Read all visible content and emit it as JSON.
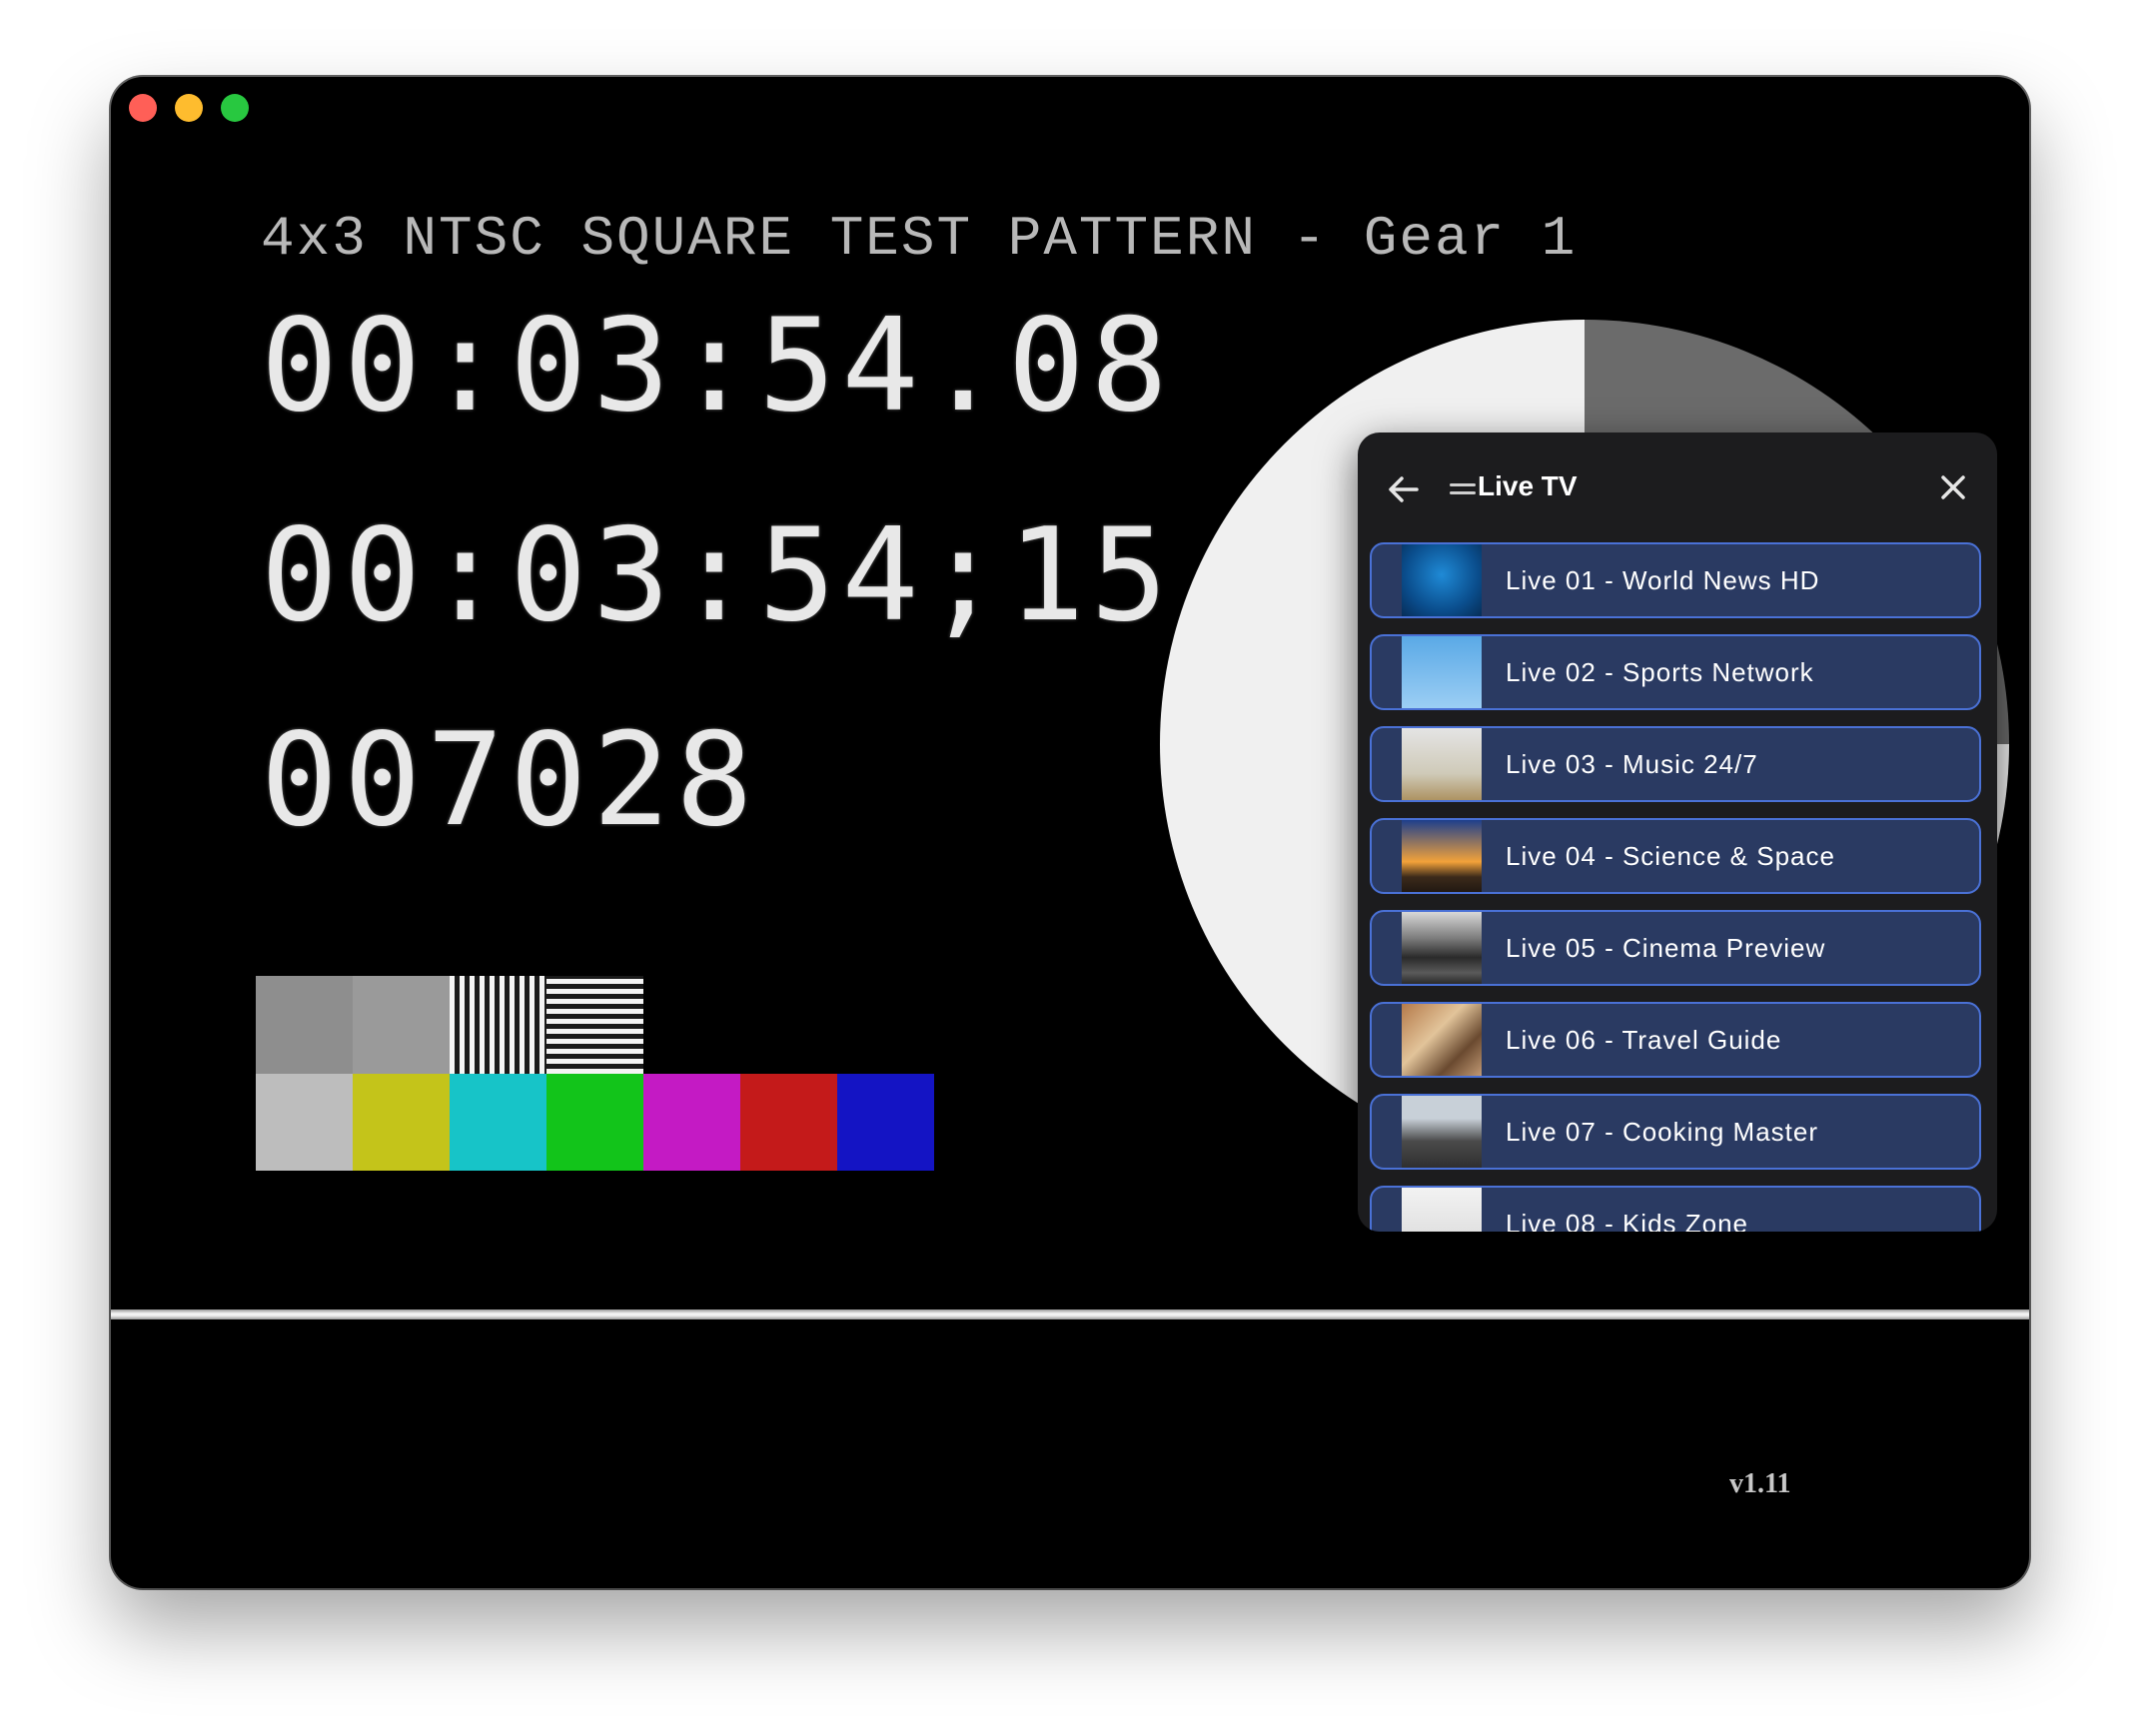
{
  "window": {
    "controls": [
      "close",
      "minimize",
      "maximize"
    ]
  },
  "video": {
    "pattern_title": "4x3 NTSC SQUARE TEST PATTERN - Gear 1",
    "timecode_decimal": "00:03:54.08",
    "timecode_frames": "00:03:54;15",
    "frame_count": "007028",
    "version": "v1.11",
    "color_bars_top": [
      "#8e8e8e",
      "#9a9a9a",
      "vertical-lines",
      "horizontal-lines"
    ],
    "color_bars_bottom": [
      "#bdbdbd",
      "#c4c41a",
      "#17c4c8",
      "#12c41a",
      "#c41ac4",
      "#c41a1a",
      "#1414c4"
    ]
  },
  "panel": {
    "title": "Live TV",
    "back_icon": "arrow-left-icon",
    "drag_icon": "drag-handle-icon",
    "close_icon": "close-icon",
    "accent_color": "#4a71d6",
    "item_background": "#2a3a62",
    "channels": [
      {
        "label": "Live 01 - World News HD",
        "thumb": "blue-water"
      },
      {
        "label": "Live 02 - Sports Network",
        "thumb": "ferris-wheel"
      },
      {
        "label": "Live 03 - Music 24/7",
        "thumb": "foggy-field"
      },
      {
        "label": "Live 04 - Science & Space",
        "thumb": "city-sunset"
      },
      {
        "label": "Live 05 - Cinema Preview",
        "thumb": "stormy-sea"
      },
      {
        "label": "Live 06 - Travel Guide",
        "thumb": "desk-items"
      },
      {
        "label": "Live 07 - Cooking Master",
        "thumb": "building"
      },
      {
        "label": "Live 08 - Kids Zone",
        "thumb": "white"
      }
    ]
  }
}
